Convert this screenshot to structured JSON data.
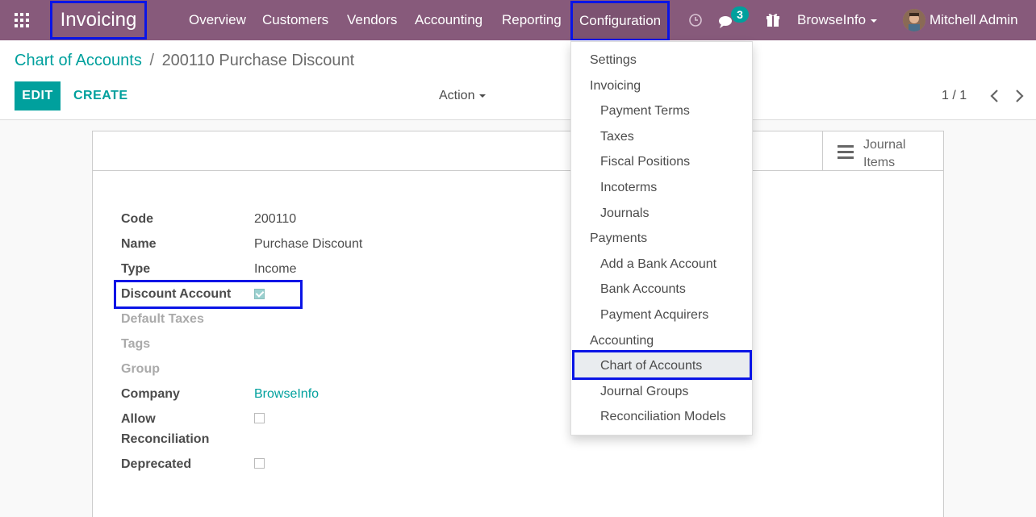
{
  "navbar": {
    "app_name": "Invoicing",
    "menu": [
      "Overview",
      "Customers",
      "Vendors",
      "Accounting",
      "Reporting",
      "Configuration"
    ],
    "message_count": "3",
    "company": "BrowseInfo",
    "user": "Mitchell Admin"
  },
  "control_panel": {
    "breadcrumb_parent": "Chart of Accounts",
    "breadcrumb_separator": "/",
    "breadcrumb_current": "200110 Purchase Discount",
    "edit_label": "EDIT",
    "create_label": "CREATE",
    "action_label": "Action",
    "pager": "1 / 1"
  },
  "form": {
    "stat_button_line1": "Journal",
    "stat_button_line2": "Items",
    "fields": {
      "code_label": "Code",
      "code_value": "200110",
      "name_label": "Name",
      "name_value": "Purchase Discount",
      "type_label": "Type",
      "type_value": "Income",
      "discount_label": "Discount Account",
      "discount_checked": true,
      "default_taxes_label": "Default Taxes",
      "tags_label": "Tags",
      "group_label": "Group",
      "company_label": "Company",
      "company_value": "BrowseInfo",
      "allow_reconciliation_label_1": "Allow",
      "allow_reconciliation_label_2": "Reconciliation",
      "allow_reconciliation_checked": false,
      "deprecated_label": "Deprecated",
      "deprecated_checked": false
    }
  },
  "config_menu": {
    "settings": "Settings",
    "invoicing_header": "Invoicing",
    "payment_terms": "Payment Terms",
    "taxes": "Taxes",
    "fiscal_positions": "Fiscal Positions",
    "incoterms": "Incoterms",
    "journals": "Journals",
    "payments_header": "Payments",
    "add_bank_account": "Add a Bank Account",
    "bank_accounts": "Bank Accounts",
    "payment_acquirers": "Payment Acquirers",
    "accounting_header": "Accounting",
    "chart_of_accounts": "Chart of Accounts",
    "journal_groups": "Journal Groups",
    "reconciliation_models": "Reconciliation Models"
  },
  "colors": {
    "navbar": "#875a7b",
    "accent": "#00a09d",
    "highlight": "#0a14e6"
  }
}
